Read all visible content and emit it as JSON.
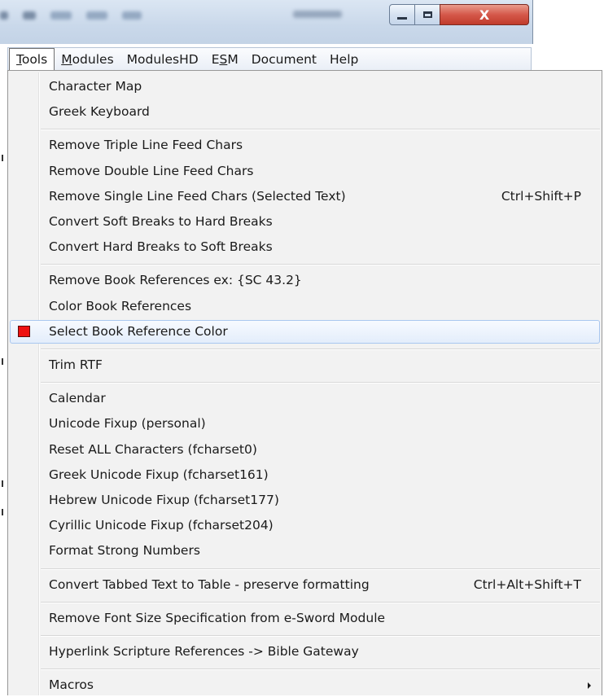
{
  "menubar": {
    "items": [
      {
        "label": "Tools",
        "mnemonic": "T",
        "rest": "ools",
        "active": true
      },
      {
        "label": "Modules",
        "mnemonic": "M",
        "rest": "odules",
        "active": false
      },
      {
        "label": "ModulesHD",
        "mnemonic": "",
        "rest": "ModulesHD",
        "active": false
      },
      {
        "label": "ESM",
        "pre": "E",
        "mnemonic": "S",
        "rest": "M",
        "active": false
      },
      {
        "label": "Document",
        "mnemonic": "",
        "rest": "Document",
        "active": false
      },
      {
        "label": "Help",
        "mnemonic": "",
        "rest": "Help",
        "active": false
      }
    ]
  },
  "window_controls": {
    "close_glyph": "X"
  },
  "tools_menu": {
    "highlighted_item": "Select Book Reference Color",
    "swatch_color": "#ee1111",
    "groups": [
      {
        "items": [
          {
            "label": "Character Map",
            "shortcut": ""
          },
          {
            "label": "Greek Keyboard",
            "shortcut": ""
          }
        ]
      },
      {
        "items": [
          {
            "label": "Remove Triple Line Feed Chars",
            "shortcut": ""
          },
          {
            "label": "Remove Double Line Feed Chars",
            "shortcut": ""
          },
          {
            "label": "Remove Single Line Feed Chars (Selected Text)",
            "shortcut": "Ctrl+Shift+P"
          },
          {
            "label": "Convert Soft Breaks to Hard Breaks",
            "shortcut": ""
          },
          {
            "label": "Convert Hard Breaks to Soft Breaks",
            "shortcut": ""
          }
        ]
      },
      {
        "items": [
          {
            "label": "Remove Book References ex: {SC 43.2}",
            "shortcut": ""
          },
          {
            "label": "Color Book References",
            "shortcut": ""
          },
          {
            "label": "Select Book Reference Color",
            "shortcut": ""
          }
        ]
      },
      {
        "items": [
          {
            "label": "Trim RTF",
            "shortcut": ""
          }
        ]
      },
      {
        "items": [
          {
            "label": "Calendar",
            "shortcut": ""
          },
          {
            "label": "Unicode Fixup (personal)",
            "shortcut": ""
          },
          {
            "label": "Reset ALL Characters (fcharset0)",
            "shortcut": ""
          },
          {
            "label": "Greek Unicode Fixup (fcharset161)",
            "shortcut": ""
          },
          {
            "label": "Hebrew Unicode Fixup (fcharset177)",
            "shortcut": ""
          },
          {
            "label": "Cyrillic Unicode Fixup (fcharset204)",
            "shortcut": ""
          },
          {
            "label": "Format Strong Numbers",
            "shortcut": ""
          }
        ]
      },
      {
        "items": [
          {
            "label": "Convert Tabbed Text to Table - preserve formatting",
            "shortcut": "Ctrl+Alt+Shift+T"
          }
        ]
      },
      {
        "items": [
          {
            "label": "Remove Font Size Specification from e-Sword Module",
            "shortcut": ""
          }
        ]
      },
      {
        "items": [
          {
            "label": "Hyperlink Scripture References -> Bible Gateway",
            "shortcut": ""
          }
        ]
      },
      {
        "items": [
          {
            "label": "Macros",
            "shortcut": "",
            "submenu": true
          }
        ]
      }
    ]
  }
}
